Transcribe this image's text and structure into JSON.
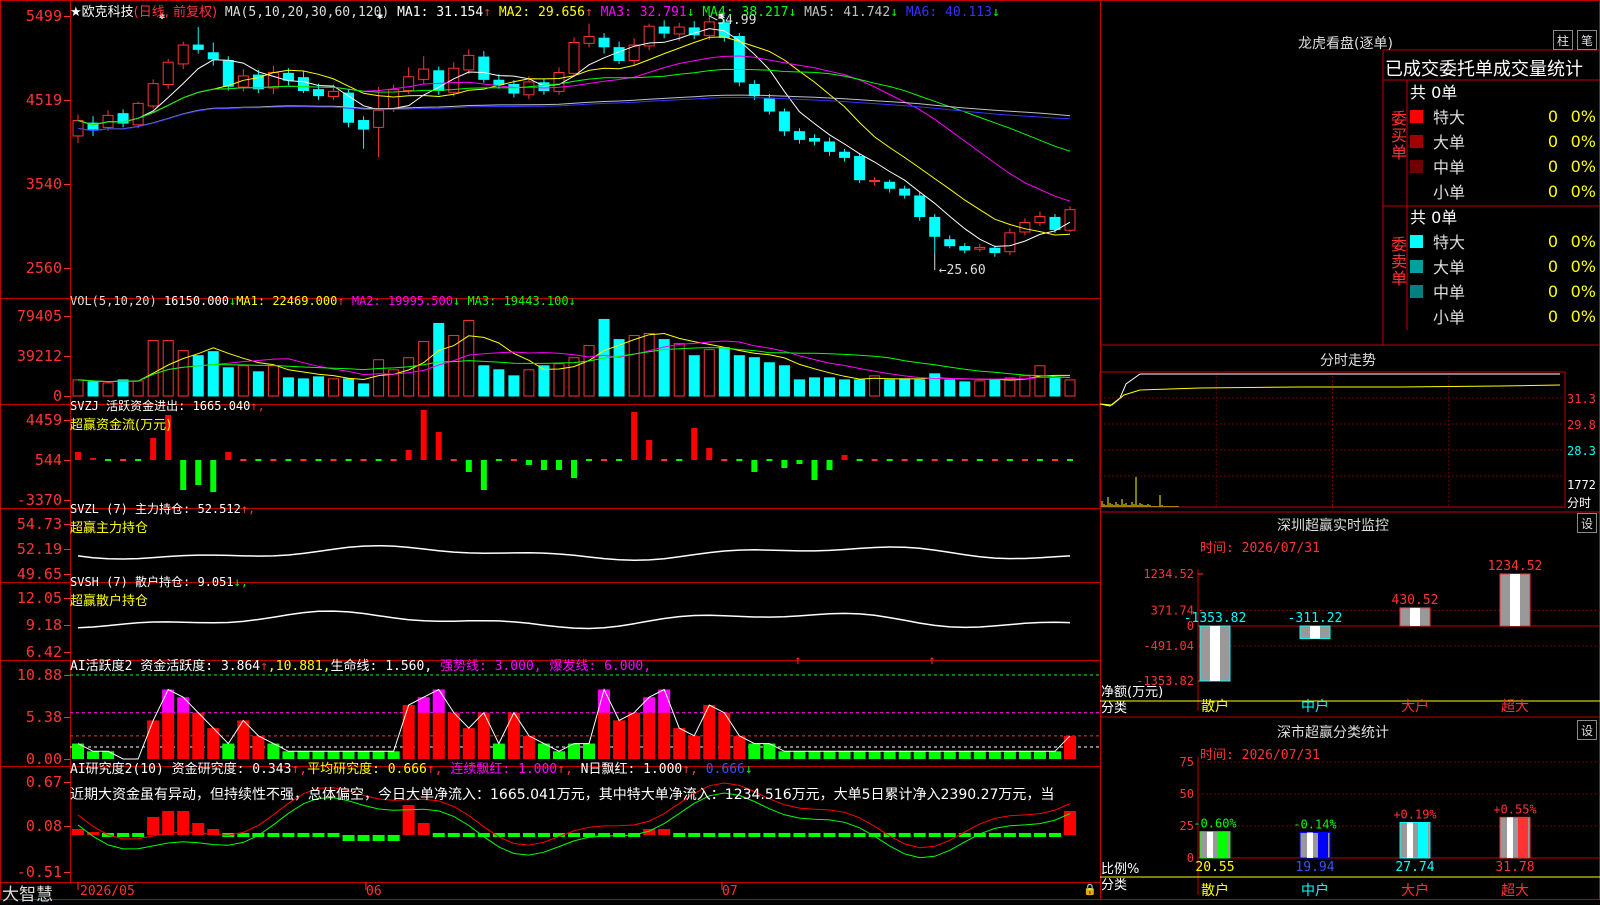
{
  "stock": {
    "title": "★欧克科技",
    "period": "(日线, 前复权)",
    "ma_header": "MA(5,10,20,30,60,120)",
    "ma_values": [
      {
        "label": "MA1:",
        "value": "31.154",
        "arrow": "↑",
        "color": "#ffffff"
      },
      {
        "label": "MA2:",
        "value": "29.656",
        "arrow": "↑",
        "color": "#ffff00"
      },
      {
        "label": "MA3:",
        "value": "32.791",
        "arrow": "↓",
        "color": "#ff00ff"
      },
      {
        "label": "MA4:",
        "value": "38.217",
        "arrow": "↓",
        "color": "#00ff00"
      },
      {
        "label": "MA5:",
        "value": "41.742",
        "arrow": "↓",
        "color": "#c0c0c0"
      },
      {
        "label": "MA6:",
        "value": "40.113",
        "arrow": "↓",
        "color": "#3333ff"
      }
    ],
    "high_label": "54.99",
    "low_label": "←25.60",
    "price_ticks": [
      "5499",
      "4519",
      "3540",
      "2560"
    ]
  },
  "vol": {
    "header": "VOL(5,10,20)",
    "value": "16150.000",
    "value_arrow": "↓",
    "ma1": "MA1: 22469.000",
    "ma1_arrow": "↑",
    "ma2": "MA2: 19995.500",
    "ma2_arrow": "↓",
    "ma3": "MA3: 19443.100",
    "ma3_arrow": "↓",
    "ticks": [
      "79405",
      "39212",
      "0"
    ]
  },
  "svzj": {
    "header": "SVZJ  活跃资金进出: 1665.040",
    "arrow": "↑,",
    "subtitle": "超赢资金流(万元)",
    "ticks": [
      "4459",
      "544",
      "-3370"
    ]
  },
  "svzl": {
    "header": "SVZL (7) 主力持仓: 52.512",
    "arrow": "↑,",
    "subtitle": "超赢主力持仓",
    "ticks": [
      "54.73",
      "52.19",
      "49.65"
    ]
  },
  "svsh": {
    "header": "SVSH (7) 散户持仓: 9.051",
    "arrow": "↓,",
    "subtitle": "超赢散户持仓",
    "ticks": [
      "12.05",
      "9.18",
      "6.42"
    ]
  },
  "ai_active": {
    "header": "AI活跃度2 资金活跃度: 3.864",
    "arrow1": "↑",
    "v2": ",10.881,",
    "v3": "生命线: 1.560,",
    "v4": "强势线: 3.000,",
    "v5": "爆发线: 6.000,",
    "ticks": [
      "10.88",
      "5.38",
      "0.00"
    ]
  },
  "ai_research": {
    "header": "AI研究度2(10) 资金研究度: 0.343",
    "arrow1": "↑,",
    "v2": "平均研究度: 0.666",
    "v2a": "↑,",
    "v3": "连续飘红: 1.000",
    "v3a": "↑,",
    "v4": "N日飘红: 1.000",
    "v4a": "↑,",
    "v5": "0.666",
    "v5a": "↓",
    "comment": "近期大资金虽有异动，但持续性不强，总体偏空，今日大单净流入：1665.041万元，其中特大单净流入：1234.516万元，大单5日累计净入2390.27万元，当",
    "ticks": [
      "0.67",
      "0.08",
      "-0.51"
    ]
  },
  "bottom": {
    "brand": "大智慧",
    "dates": [
      "2026/05",
      "06",
      "07"
    ]
  },
  "dragon": {
    "title": "龙虎看盘(逐单)",
    "btn1": "柱",
    "btn2": "笔",
    "header": "已成交委托单成交量统计",
    "buy_label": "委买单",
    "sell_label": "委卖单",
    "buy_total": "共 0单",
    "sell_total": "共 0单",
    "buy_rows": [
      {
        "name": "特大",
        "count": "0",
        "pct": "0%",
        "color": "#ff0000"
      },
      {
        "name": "大单",
        "count": "0",
        "pct": "0%",
        "color": "#a00000"
      },
      {
        "name": "中单",
        "count": "0",
        "pct": "0%",
        "color": "#700000"
      },
      {
        "name": "小单",
        "count": "0",
        "pct": "0%",
        "color": "#000000"
      }
    ],
    "sell_rows": [
      {
        "name": "特大",
        "count": "0",
        "pct": "0%",
        "color": "#00ffff"
      },
      {
        "name": "大单",
        "count": "0",
        "pct": "0%",
        "color": "#00a0a0"
      },
      {
        "name": "中单",
        "count": "0",
        "pct": "0%",
        "color": "#008080"
      },
      {
        "name": "小单",
        "count": "0",
        "pct": "0%",
        "color": "#000000"
      }
    ]
  },
  "intraday": {
    "title": "分时走势",
    "labels": [
      "31.3",
      "29.8",
      "28.3",
      "1772",
      "分时"
    ]
  },
  "monitor": {
    "title": "深圳超赢实时监控",
    "btn": "设",
    "time": "时间: 2026/07/31",
    "ticks": [
      "1234.52",
      "371.74",
      "0",
      "-491.04",
      "-1353.82"
    ],
    "axis_label1": "净额(万元)",
    "axis_label2": "分类",
    "categories": [
      "散户",
      "中户",
      "大户",
      "超大"
    ],
    "values": [
      -1353.82,
      -311.22,
      430.52,
      1234.52
    ],
    "value_labels": [
      "-1353.82",
      "-311.22",
      "430.52",
      "1234.52"
    ]
  },
  "classify": {
    "title": "深市超赢分类统计",
    "btn": "设",
    "time": "时间: 2026/07/31",
    "ticks": [
      "75",
      "50",
      "25",
      "0"
    ],
    "axis_label1": "比例%",
    "axis_label2": "分类",
    "categories": [
      "散户",
      "中户",
      "大户",
      "超大"
    ],
    "values": [
      20.55,
      19.94,
      27.74,
      31.78
    ],
    "value_labels": [
      "20.55",
      "19.94",
      "27.74",
      "31.78"
    ],
    "changes": [
      "-0.60%",
      "-0.14%",
      "+0.19%",
      "+0.55%"
    ]
  },
  "chart_data": [
    {
      "type": "bar",
      "title": "深圳超赢实时监控",
      "ylabel": "净额(万元)",
      "xlabel": "分类",
      "categories": [
        "散户",
        "中户",
        "大户",
        "超大"
      ],
      "values": [
        -1353.82,
        -311.22,
        430.52,
        1234.52
      ],
      "ylim": [
        -1353.82,
        1234.52
      ]
    },
    {
      "type": "bar",
      "title": "深市超赢分类统计",
      "ylabel": "比例%",
      "xlabel": "分类",
      "categories": [
        "散户",
        "中户",
        "大户",
        "超大"
      ],
      "values": [
        20.55,
        19.94,
        27.74,
        31.78
      ],
      "ylim": [
        0,
        75
      ]
    }
  ]
}
